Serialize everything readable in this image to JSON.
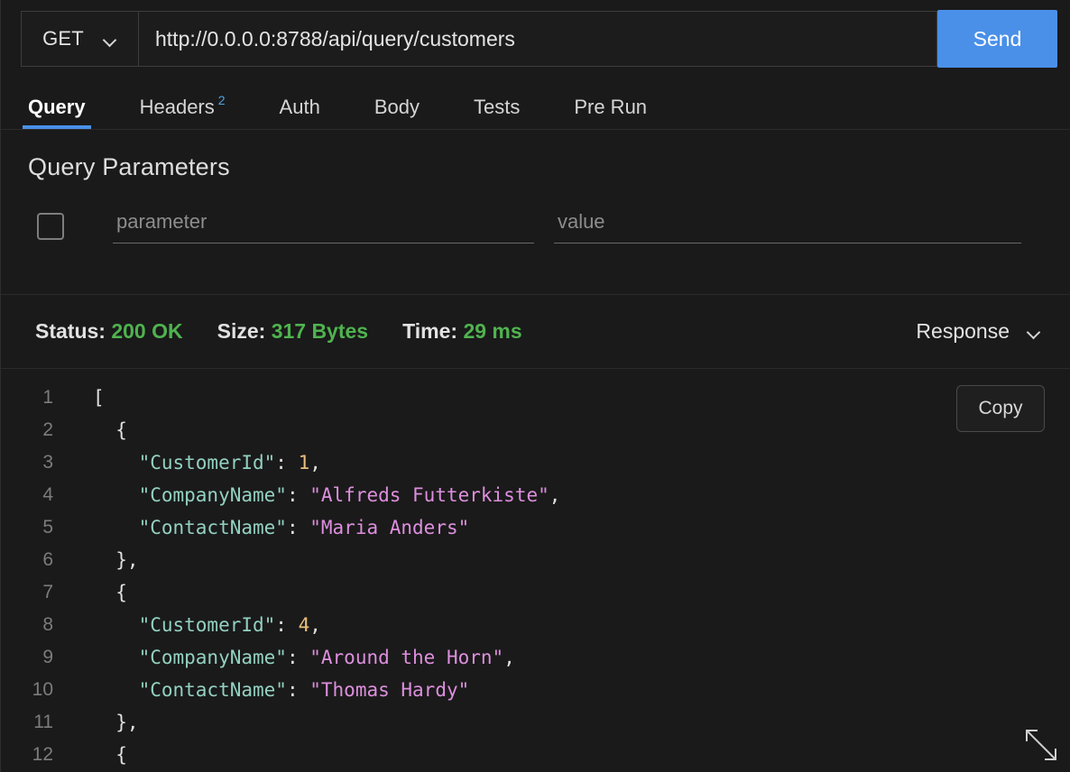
{
  "request": {
    "method": "GET",
    "method_chevron_icon": "chevron-down-icon",
    "url": "http://0.0.0.0:8788/api/query/customers",
    "url_placeholder": "Enter URL",
    "send_label": "Send"
  },
  "tabs": [
    {
      "label": "Query",
      "badge": null,
      "active": true
    },
    {
      "label": "Headers",
      "badge": "2",
      "active": false
    },
    {
      "label": "Auth",
      "badge": null,
      "active": false
    },
    {
      "label": "Body",
      "badge": null,
      "active": false
    },
    {
      "label": "Tests",
      "badge": null,
      "active": false
    },
    {
      "label": "Pre Run",
      "badge": null,
      "active": false
    }
  ],
  "query_params": {
    "title": "Query Parameters",
    "rows": [
      {
        "checked": false,
        "param_value": "",
        "param_placeholder": "parameter",
        "value_value": "",
        "value_placeholder": "value"
      }
    ]
  },
  "response_status": {
    "status_label": "Status:",
    "status_value": "200 OK",
    "size_label": "Size:",
    "size_value": "317 Bytes",
    "time_label": "Time:",
    "time_value": "29 ms",
    "view_selector_label": "Response",
    "view_selector_icon": "chevron-down-icon",
    "ok_color": "#4fb34f"
  },
  "response_body": {
    "copy_label": "Copy",
    "resize_icon": "diagonal-resize-icon",
    "lines": [
      {
        "n": "1",
        "tokens": [
          {
            "t": "punct",
            "v": "["
          }
        ]
      },
      {
        "n": "2",
        "tokens": [
          {
            "t": "punct",
            "v": "  {"
          }
        ]
      },
      {
        "n": "3",
        "tokens": [
          {
            "t": "punct",
            "v": "    "
          },
          {
            "t": "key",
            "v": "\"CustomerId\""
          },
          {
            "t": "punct",
            "v": ": "
          },
          {
            "t": "num",
            "v": "1"
          },
          {
            "t": "punct",
            "v": ","
          }
        ]
      },
      {
        "n": "4",
        "tokens": [
          {
            "t": "punct",
            "v": "    "
          },
          {
            "t": "key",
            "v": "\"CompanyName\""
          },
          {
            "t": "punct",
            "v": ": "
          },
          {
            "t": "str",
            "v": "\"Alfreds Futterkiste\""
          },
          {
            "t": "punct",
            "v": ","
          }
        ]
      },
      {
        "n": "5",
        "tokens": [
          {
            "t": "punct",
            "v": "    "
          },
          {
            "t": "key",
            "v": "\"ContactName\""
          },
          {
            "t": "punct",
            "v": ": "
          },
          {
            "t": "str",
            "v": "\"Maria Anders\""
          }
        ]
      },
      {
        "n": "6",
        "tokens": [
          {
            "t": "punct",
            "v": "  },"
          }
        ]
      },
      {
        "n": "7",
        "tokens": [
          {
            "t": "punct",
            "v": "  {"
          }
        ]
      },
      {
        "n": "8",
        "tokens": [
          {
            "t": "punct",
            "v": "    "
          },
          {
            "t": "key",
            "v": "\"CustomerId\""
          },
          {
            "t": "punct",
            "v": ": "
          },
          {
            "t": "num",
            "v": "4"
          },
          {
            "t": "punct",
            "v": ","
          }
        ]
      },
      {
        "n": "9",
        "tokens": [
          {
            "t": "punct",
            "v": "    "
          },
          {
            "t": "key",
            "v": "\"CompanyName\""
          },
          {
            "t": "punct",
            "v": ": "
          },
          {
            "t": "str",
            "v": "\"Around the Horn\""
          },
          {
            "t": "punct",
            "v": ","
          }
        ]
      },
      {
        "n": "10",
        "tokens": [
          {
            "t": "punct",
            "v": "    "
          },
          {
            "t": "key",
            "v": "\"ContactName\""
          },
          {
            "t": "punct",
            "v": ": "
          },
          {
            "t": "str",
            "v": "\"Thomas Hardy\""
          }
        ]
      },
      {
        "n": "11",
        "tokens": [
          {
            "t": "punct",
            "v": "  },"
          }
        ]
      },
      {
        "n": "12",
        "tokens": [
          {
            "t": "punct",
            "v": "  {"
          }
        ]
      }
    ]
  },
  "theme": {
    "accent": "#4a90e8",
    "background": "#1a1a1a",
    "ok_green": "#4fb34f",
    "key_color": "#93d1c0",
    "string_color": "#dd8fdd",
    "number_color": "#e8c07d"
  }
}
